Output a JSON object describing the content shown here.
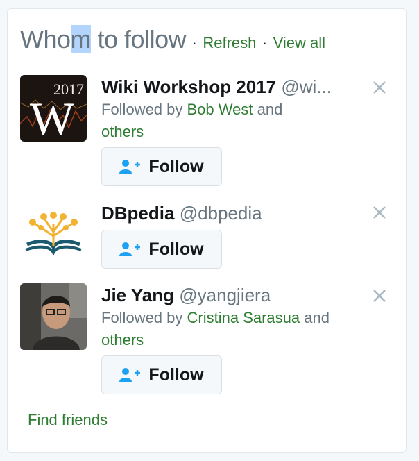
{
  "header": {
    "title_part1": "Who",
    "title_highlight": "m",
    "title_part2": " to follow",
    "dot": "·",
    "refresh": "Refresh",
    "view_all": "View all"
  },
  "suggestions": [
    {
      "name": "Wiki Workshop 2017",
      "handle": "@wi...",
      "followed_by_prefix": "Followed by",
      "followed_by_name": "Bob West",
      "followed_by_suffix": "and",
      "others": "others",
      "avatar_text_year": "2017",
      "avatar_text_letter": "W",
      "follow_label": "Follow"
    },
    {
      "name": "DBpedia",
      "handle": "@dbpedia",
      "follow_label": "Follow"
    },
    {
      "name": "Jie Yang",
      "handle": "@yangjiera",
      "followed_by_prefix": "Followed by",
      "followed_by_name": "Cristina Sarasua",
      "followed_by_suffix": "and",
      "others": "others",
      "follow_label": "Follow"
    }
  ],
  "footer": {
    "find_friends": "Find friends"
  },
  "colors": {
    "link": "#2e7d32",
    "follow_icon": "#1da1f2",
    "muted": "#66757f"
  }
}
